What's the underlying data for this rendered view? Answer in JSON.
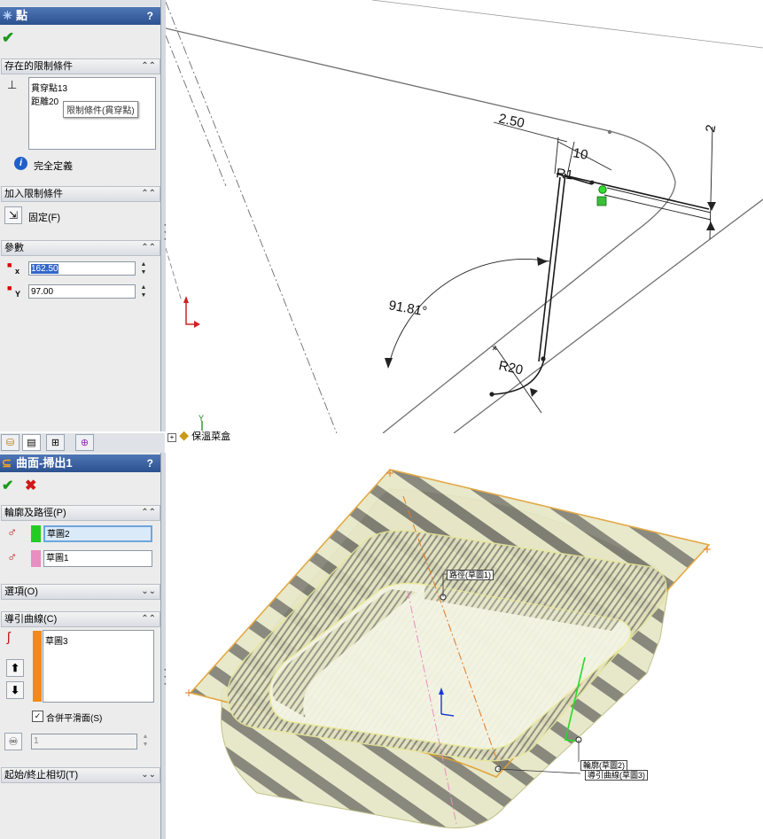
{
  "top_panel": {
    "title": "點",
    "help": "?",
    "existing_relations": {
      "header": "存在的限制條件",
      "items": [
        "貫穿點13",
        "距離20"
      ],
      "tooltip": "限制條件(貫穿點)",
      "status": "完全定義"
    },
    "add_relations": {
      "header": "加入限制條件",
      "fixed_label": "固定(F)"
    },
    "parameters": {
      "header": "參數",
      "x_label": "x",
      "y_label": "Y",
      "x_value": "162.50",
      "y_value": "97.00"
    }
  },
  "sketch_view": {
    "dimensions": [
      "2.50",
      "10",
      "2",
      "R1",
      "91.81°",
      "R20"
    ]
  },
  "bottom_panel": {
    "title": "曲面-掃出1",
    "help": "?",
    "tree_node": "保溫菜盒",
    "profile_path": {
      "header": "輪廓及路徑(P)",
      "profile": "草圖2",
      "path": "草圖1"
    },
    "options": {
      "header": "選項(O)"
    },
    "guide_curves": {
      "header": "導引曲線(C)",
      "items": [
        "草圖3"
      ],
      "merge_label": "合併平滑面(S)",
      "merge_checked": true,
      "count": "1"
    },
    "tangency": {
      "header": "起始/終止相切(T)"
    }
  },
  "model_view": {
    "callouts": {
      "path": "路徑(草圖1)",
      "profile": "輪廓(草圖2)",
      "guide": "導引曲線(草圖3)"
    }
  },
  "colors": {
    "title_bar": "#2c518f",
    "profile_swatch": "#22cc22",
    "path_swatch": "#e78fc0",
    "guide_swatch": "#f08a1c",
    "model_edge": "#e0a030",
    "model_fill": "#d8d8a8"
  }
}
